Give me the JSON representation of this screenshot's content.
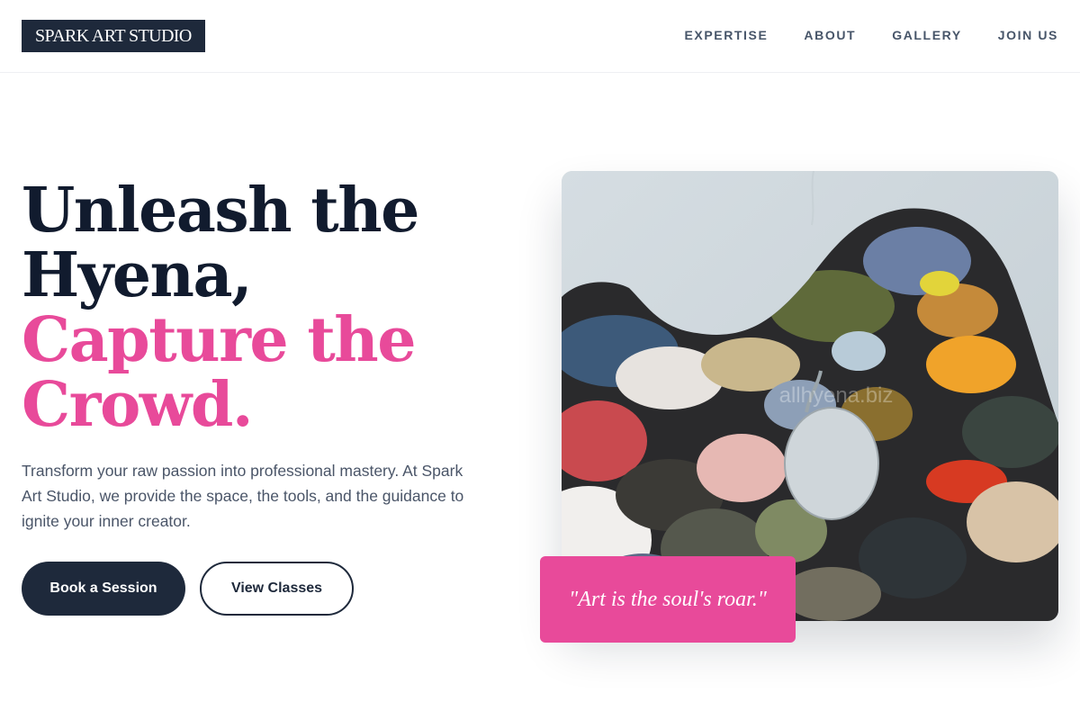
{
  "brand": {
    "name": "SPARK ART STUDIO"
  },
  "nav": {
    "items": [
      {
        "label": "EXPERTISE"
      },
      {
        "label": "ABOUT"
      },
      {
        "label": "GALLERY"
      },
      {
        "label": "JOIN US"
      }
    ]
  },
  "hero": {
    "title_line1": "Unleash the",
    "title_line2": "Hyena,",
    "title_line3": "Capture the",
    "title_line4": "Crowd.",
    "description": "Transform your raw passion into professional mastery. At Spark Art Studio, we provide the space, the tools, and the guidance to ignite your inner creator.",
    "primary_button": "Book a Session",
    "secondary_button": "View Classes",
    "image": {
      "watermark": "allhyena.biz"
    },
    "quote": "\"Art is the soul's roar.\""
  },
  "colors": {
    "navy": "#1e293b",
    "accent_pink": "#e84a9a",
    "text_muted": "#4a5568"
  }
}
